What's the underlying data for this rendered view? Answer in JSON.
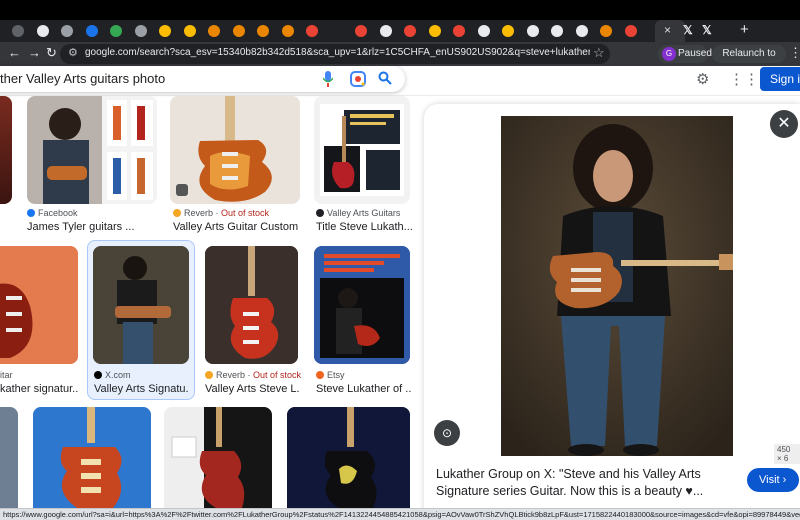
{
  "browser": {
    "active_tab_close": "×",
    "x_tabs": [
      "𝕏",
      "𝕏"
    ],
    "new_tab": "+",
    "url": "google.com/search?sca_esv=15340b82b342d518&sca_upv=1&rlz=1C5CHFA_enUS902US902&q=steve+lukather+Valley+Arts+guitars+ph...",
    "profile_initial": "G",
    "profile_label": "Paused",
    "relaunch_label": "Relaunch to update",
    "tab_colors": [
      "#5f6368",
      "#e8eaed",
      "#9aa0a6",
      "#1a73e8",
      "#34a853",
      "#9aa0a6",
      "#fbbc04",
      "#fbbc04",
      "#ea8600",
      "#ea8600",
      "#ea8600",
      "#ea8600",
      "#ea4335",
      "#202124",
      "#ea4335",
      "#e8eaed",
      "#ea4335",
      "#fbbc04",
      "#ea4335",
      "#e8eaed",
      "#fbbc04",
      "#e8eaed",
      "#e8eaed",
      "#e8eaed",
      "#ea8600",
      "#ea4335"
    ]
  },
  "search": {
    "query": "ther Valley Arts guitars photo",
    "signin_label": "Sign in"
  },
  "grid": {
    "row1": [
      {
        "source": "Facebook",
        "title": "James Tyler guitars ..."
      },
      {
        "source": "Reverb",
        "badge": "Out of stock",
        "title": "Valley Arts Guitar Custom ..."
      },
      {
        "source": "Valley Arts Guitars",
        "title": "Title Steve Lukath..."
      }
    ],
    "row2": [
      {
        "source": "itar",
        "title": "kather signatur..."
      },
      {
        "source": "X.com",
        "title": "Valley Arts Signatu..."
      },
      {
        "source": "Reverb",
        "badge": "Out of stock",
        "title": "Valley Arts Steve L..."
      },
      {
        "source": "Etsy",
        "title": "Steve Lukather of ..."
      }
    ]
  },
  "panel": {
    "dimensions": "450 × 6",
    "caption": "Lukather Group on X: \"Steve and his Valley Arts Signature series Guitar. Now this is a beauty ♥...",
    "visit_label": "Visit ›"
  },
  "status_bar": "https://www.google.com/url?sa=i&url=https%3A%2F%2Ftwitter.com%2FLukatherGroup%2Fstatus%2F1413224454885421058&psig=AOvVaw0TrShZVhQLBtick9b8zLpF&ust=1715822440183000&source=images&cd=vfe&opi=89978449&ved=0CBAQ..."
}
